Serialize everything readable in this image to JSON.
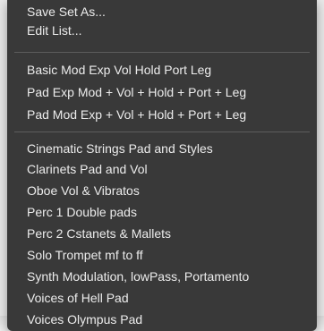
{
  "menu": {
    "group_actions": [
      {
        "label": "Save Set As..."
      },
      {
        "label": "Edit List..."
      }
    ],
    "group_basic": [
      {
        "label": "Basic Mod Exp Vol Hold Port Leg"
      },
      {
        "label": "Pad Exp Mod + Vol + Hold + Port + Leg"
      },
      {
        "label": "Pad Mod Exp + Vol + Hold + Port + Leg"
      }
    ],
    "group_sets": [
      {
        "label": "Cinematic Strings Pad and Styles"
      },
      {
        "label": "Clarinets Pad and Vol"
      },
      {
        "label": "Oboe Vol & Vibratos"
      },
      {
        "label": "Perc 1 Double pads"
      },
      {
        "label": "Perc 2 Cstanets & Mallets"
      },
      {
        "label": "Solo Trompet mf to ff"
      },
      {
        "label": "Synth Modulation, lowPass, Portamento"
      },
      {
        "label": "Voices of Hell Pad"
      },
      {
        "label": "Voices Olympus Pad"
      }
    ]
  }
}
